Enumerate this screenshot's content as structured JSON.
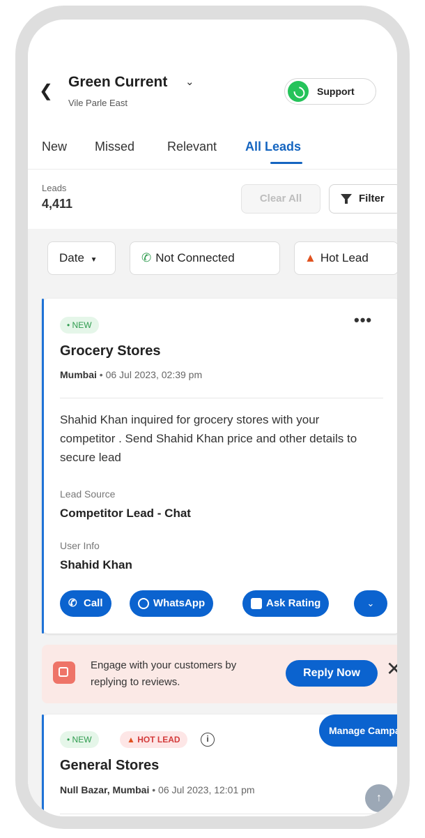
{
  "header": {
    "back_icon": "chevron-left-icon",
    "title": "Green Current",
    "title_chevron": "chevron-down-icon",
    "subtitle": "Vile Parle East",
    "support_label": "Support",
    "support_icon": "whatsapp-icon",
    "menu_icon": "kebab-menu-icon"
  },
  "tabs": [
    {
      "label": "New"
    },
    {
      "label": "Missed"
    },
    {
      "label": "Relevant"
    },
    {
      "label": "All Leads",
      "active": true
    }
  ],
  "leads": {
    "label": "Leads",
    "count": "4,411",
    "clear_label": "Clear All",
    "filter_label": "Filter"
  },
  "chips": [
    {
      "label": "Date",
      "icon": "caret-down-icon"
    },
    {
      "label": "Not Connected",
      "icon": "phone-missed-icon"
    },
    {
      "label": "Hot Lead",
      "icon": "fire-icon"
    }
  ],
  "cards": [
    {
      "badge_new": "• NEW",
      "title": "Grocery Stores",
      "location": "Mumbai",
      "datetime": "06 Jul 2023, 02:39 pm",
      "description": "Shahid Khan inquired for grocery stores with your competitor . Send Shahid Khan price and other details to secure lead",
      "lead_source_label": "Lead Source",
      "lead_source": "Competitor Lead - Chat",
      "user_info_label": "User Info",
      "user_info": "Shahid Khan",
      "actions": [
        {
          "label": "Call",
          "icon": "phone-icon"
        },
        {
          "label": "WhatsApp",
          "icon": "whatsapp-icon"
        },
        {
          "label": "Ask Rating",
          "icon": "star-message-icon"
        }
      ]
    },
    {
      "badge_new": "• NEW",
      "badge_hot": "HOT LEAD",
      "title": "General Stores",
      "location": "Null Bazar, Mumbai",
      "datetime": "06 Jul 2023, 12:01 pm"
    }
  ],
  "engage": {
    "text": "Engage with your customers by replying to reviews.",
    "reply_label": "Reply Now",
    "close_icon": "close-icon"
  },
  "manage_campaign": "Manage Campaign",
  "colors": {
    "accent": "#0b63cf",
    "tab_active": "#1565c0",
    "new_badge": "#2e9b4e",
    "hot_badge": "#d33b3b"
  }
}
